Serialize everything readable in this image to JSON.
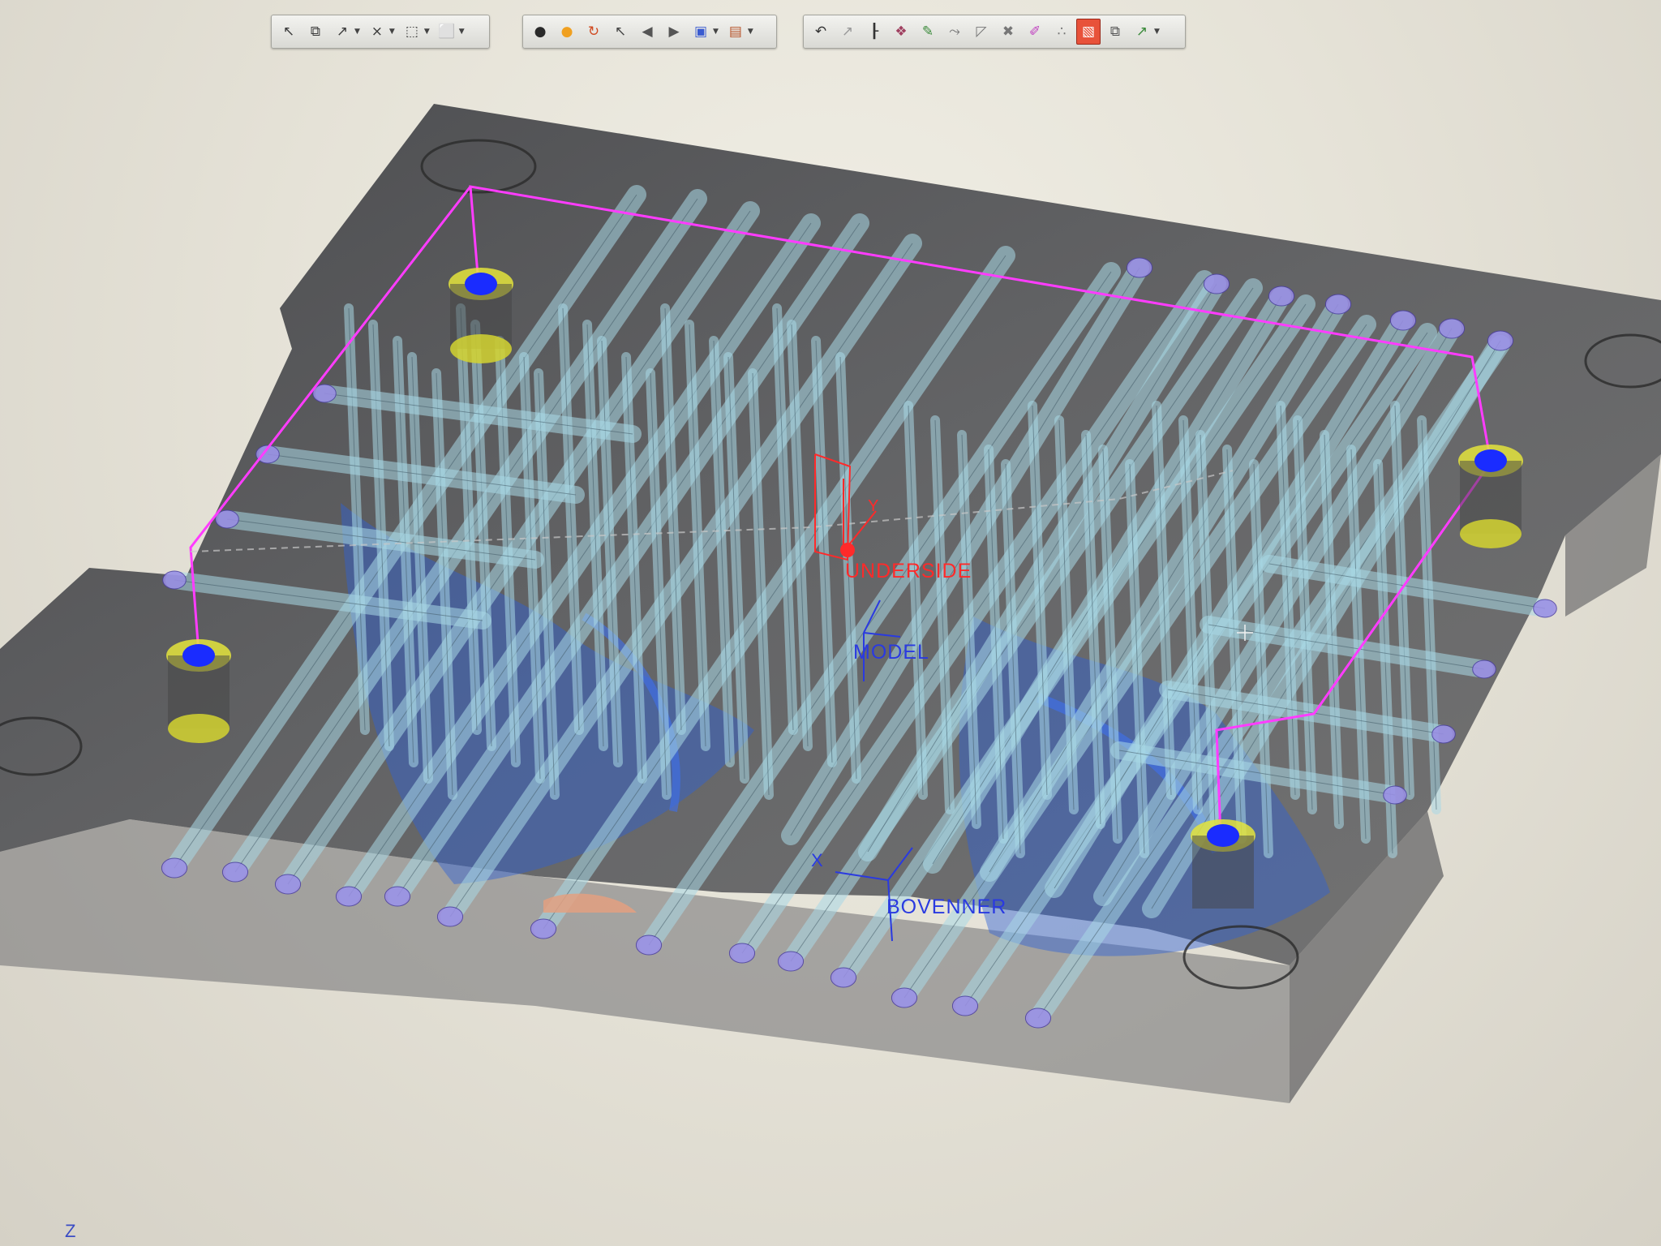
{
  "toolbar": {
    "group1": [
      {
        "icon": "select-deselect-icon",
        "glyph": "↖",
        "dropdown": false
      },
      {
        "icon": "select-box-icon",
        "glyph": "⧉",
        "dropdown": false
      },
      {
        "icon": "select-filter-icon",
        "glyph": "↗",
        "dropdown": true
      },
      {
        "icon": "select-feature-icon",
        "glyph": "⨯",
        "dropdown": true
      },
      {
        "icon": "select-region-icon",
        "glyph": "⬚",
        "dropdown": true
      },
      {
        "icon": "select-window-icon",
        "glyph": "⬜",
        "dropdown": true
      }
    ],
    "group2": [
      {
        "icon": "light-bulb-icon",
        "glyph": "●",
        "dropdown": false,
        "color": "#2a2a2a"
      },
      {
        "icon": "light-bulb-on-icon",
        "glyph": "●",
        "dropdown": false,
        "color": "#f0a020"
      },
      {
        "icon": "refresh-lights-icon",
        "glyph": "↻",
        "dropdown": false,
        "color": "#d04a20"
      },
      {
        "icon": "pointer-query-icon",
        "glyph": "↖",
        "dropdown": false,
        "color": "#444"
      },
      {
        "icon": "view-back-icon",
        "glyph": "◀",
        "dropdown": false,
        "color": "#555"
      },
      {
        "icon": "view-forward-icon",
        "glyph": "▶",
        "dropdown": false,
        "color": "#555"
      },
      {
        "icon": "layer-display-icon",
        "glyph": "▣",
        "dropdown": true,
        "color": "#3a5bd0"
      },
      {
        "icon": "render-style-icon",
        "glyph": "▤",
        "dropdown": true,
        "color": "#b8542a"
      }
    ],
    "group3": [
      {
        "icon": "undo-icon",
        "glyph": "↶",
        "dropdown": false,
        "color": "#333"
      },
      {
        "icon": "feature-tree-icon",
        "glyph": "↗",
        "dropdown": false,
        "color": "#999"
      },
      {
        "icon": "datum-axis-icon",
        "glyph": "┠",
        "dropdown": false,
        "color": "#333"
      },
      {
        "icon": "assembly-icon",
        "glyph": "❖",
        "dropdown": false,
        "color": "#a04060"
      },
      {
        "icon": "edit-feature-icon",
        "glyph": "✎",
        "dropdown": false,
        "color": "#3a8a3a"
      },
      {
        "icon": "csys-icon",
        "glyph": "⤳",
        "dropdown": false,
        "color": "#777"
      },
      {
        "icon": "plane-icon",
        "glyph": "◸",
        "dropdown": false,
        "color": "#777"
      },
      {
        "icon": "point-icon",
        "glyph": "✖",
        "dropdown": false,
        "color": "#777"
      },
      {
        "icon": "sketch-icon",
        "glyph": "✐",
        "dropdown": false,
        "color": "#c040c0"
      },
      {
        "icon": "pattern-icon",
        "glyph": "∴",
        "dropdown": false,
        "color": "#777"
      },
      {
        "icon": "cooling-channel-icon",
        "glyph": "▧",
        "dropdown": false,
        "color": "#fff",
        "active": true
      },
      {
        "icon": "mold-component-icon",
        "glyph": "⧉",
        "dropdown": false,
        "color": "#555"
      },
      {
        "icon": "analysis-icon",
        "glyph": "↗",
        "dropdown": true,
        "color": "#3a8a3a"
      }
    ]
  },
  "viewport": {
    "csys_labels": {
      "underside": "UNDERSIDE",
      "model": "MODEL",
      "bovenner": "BOVENNER",
      "axis_y": "Y",
      "axis_x": "X",
      "axis_z": "Z"
    },
    "orientation_indicator": "Z",
    "colors": {
      "mold_plate": "#4f5054",
      "cooling_channel": "#a9d9e6",
      "channel_end": "#9a8ee6",
      "inlet_ring": "#e4e43c",
      "inlet_core": "#1a2cff",
      "circuit_line": "#ff3cff",
      "cavity": "#2f62d8",
      "csys_red": "#ff2a2a",
      "csys_blue": "#2a3ae0"
    }
  }
}
